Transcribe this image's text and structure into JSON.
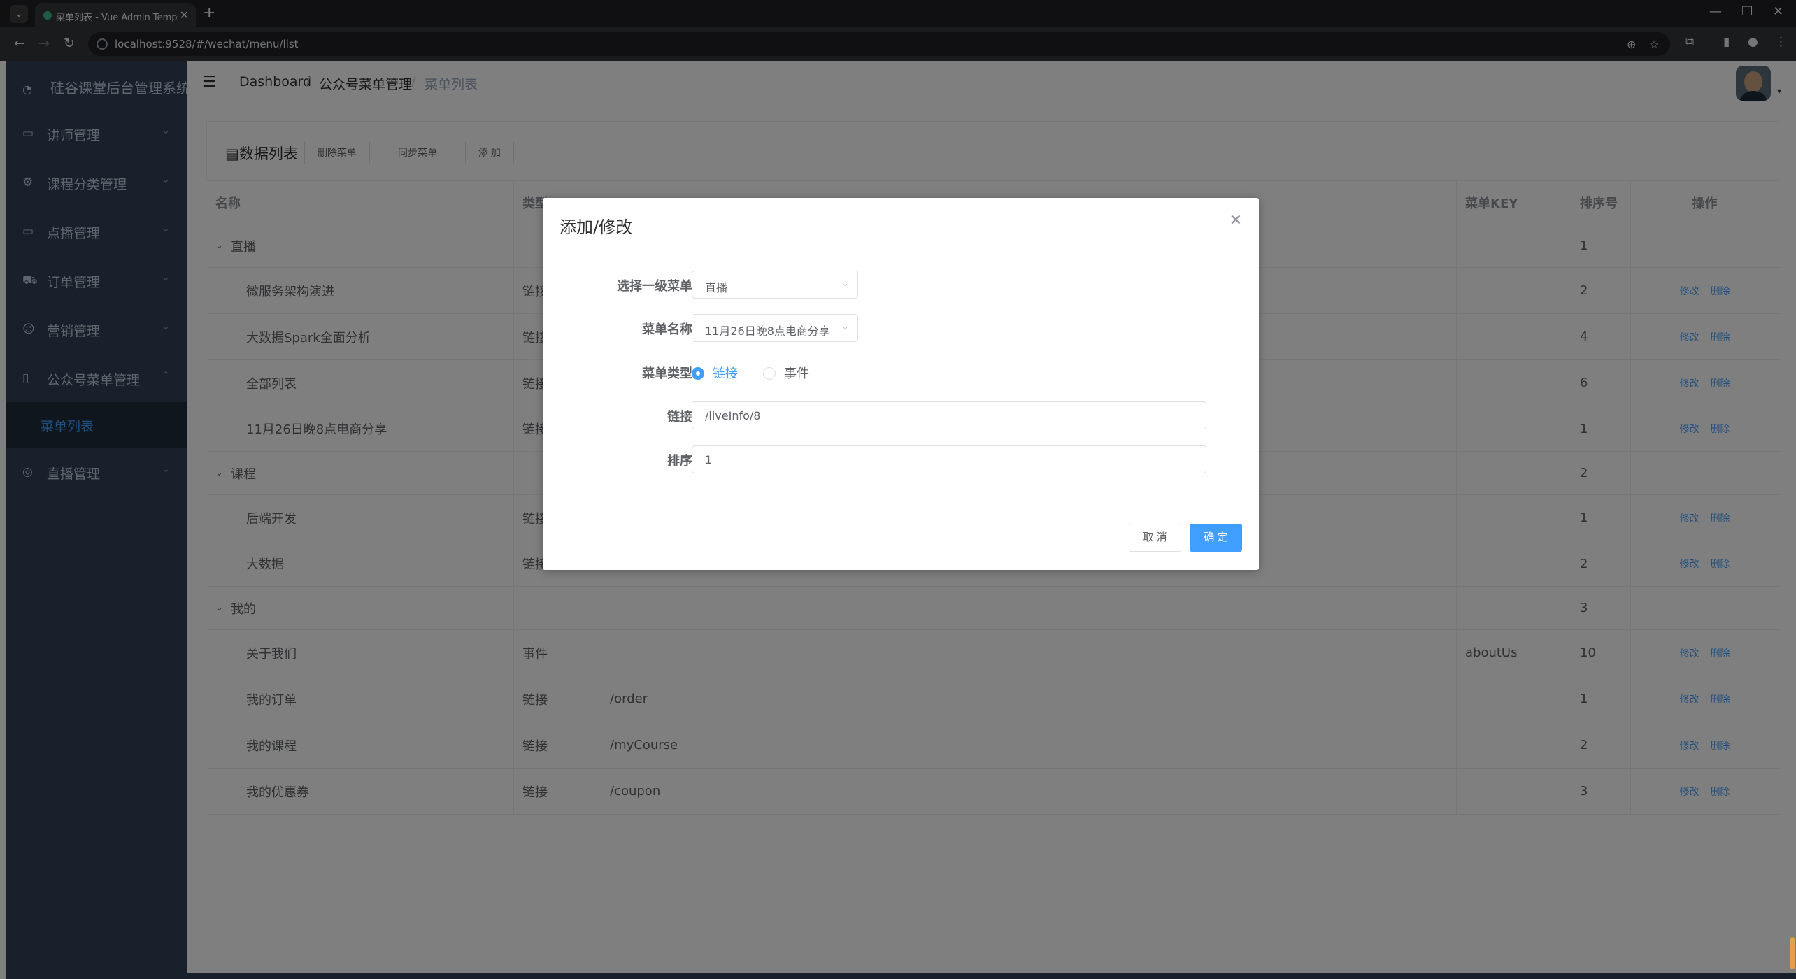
{
  "browser": {
    "tab_title": "菜单列表 - Vue Admin Template",
    "url": "localhost:9528/#/wechat/menu/list",
    "new_tab_symbol": "+",
    "close_symbol": "✕",
    "window_controls": [
      "—",
      "❐",
      "✕"
    ]
  },
  "sidebar": {
    "logo_text": "硅谷课堂后台管理系统",
    "items": [
      {
        "label": "讲师管理",
        "icon": "table-icon"
      },
      {
        "label": "课程分类管理",
        "icon": "category-icon"
      },
      {
        "label": "点播管理",
        "icon": "video-icon"
      },
      {
        "label": "订单管理",
        "icon": "truck-icon"
      },
      {
        "label": "营销管理",
        "icon": "smile-icon"
      },
      {
        "label": "公众号菜单管理",
        "icon": "phone-icon"
      },
      {
        "label": "直播管理",
        "icon": "live-icon"
      }
    ],
    "active_sub": "菜单列表"
  },
  "breadcrumb": {
    "items": [
      "Dashboard",
      "公众号菜单管理",
      "菜单列表"
    ],
    "separator": "/"
  },
  "panel": {
    "title": "数据列表",
    "buttons": {
      "delete_menu": "删除菜单",
      "sync_menu": "同步菜单",
      "add": "添 加"
    }
  },
  "table": {
    "headers": {
      "name": "名称",
      "type": "类型",
      "url": "",
      "key": "菜单KEY",
      "sort": "排序号",
      "ops": "操作"
    },
    "op_edit": "修改",
    "op_delete": "删除",
    "rows": [
      {
        "name": "直播",
        "type": "",
        "url": "",
        "key": "",
        "sort": "1",
        "parent": true,
        "ops": false
      },
      {
        "name": "微服务架构演进",
        "type": "链接",
        "url": "",
        "key": "",
        "sort": "2",
        "parent": false,
        "ops": true
      },
      {
        "name": "大数据Spark全面分析",
        "type": "链接",
        "url": "",
        "key": "",
        "sort": "4",
        "parent": false,
        "ops": true
      },
      {
        "name": "全部列表",
        "type": "链接",
        "url": "",
        "key": "",
        "sort": "6",
        "parent": false,
        "ops": true
      },
      {
        "name": "11月26日晚8点电商分享",
        "type": "链接",
        "url": "",
        "key": "",
        "sort": "1",
        "parent": false,
        "ops": true
      },
      {
        "name": "课程",
        "type": "",
        "url": "",
        "key": "",
        "sort": "2",
        "parent": true,
        "ops": false
      },
      {
        "name": "后端开发",
        "type": "链接",
        "url": "",
        "key": "",
        "sort": "1",
        "parent": false,
        "ops": true
      },
      {
        "name": "大数据",
        "type": "链接",
        "url": "",
        "key": "",
        "sort": "2",
        "parent": false,
        "ops": true
      },
      {
        "name": "我的",
        "type": "",
        "url": "",
        "key": "",
        "sort": "3",
        "parent": true,
        "ops": false
      },
      {
        "name": "关于我们",
        "type": "事件",
        "url": "",
        "key": "aboutUs",
        "sort": "10",
        "parent": false,
        "ops": true
      },
      {
        "name": "我的订单",
        "type": "链接",
        "url": "/order",
        "key": "",
        "sort": "1",
        "parent": false,
        "ops": true
      },
      {
        "name": "我的课程",
        "type": "链接",
        "url": "/myCourse",
        "key": "",
        "sort": "2",
        "parent": false,
        "ops": true
      },
      {
        "name": "我的优惠券",
        "type": "链接",
        "url": "/coupon",
        "key": "",
        "sort": "3",
        "parent": false,
        "ops": true
      }
    ]
  },
  "dialog": {
    "title": "添加/修改",
    "parent_menu_label": "选择一级菜单",
    "parent_menu_value": "直播",
    "menu_name_label": "菜单名称",
    "menu_name_value": "11月26日晚8点电商分享",
    "menu_type_label": "菜单类型",
    "type_options": [
      "链接",
      "事件"
    ],
    "selected_type": "链接",
    "url_label": "链接",
    "url_value": "/liveInfo/8",
    "sort_label": "排序",
    "sort_value": "1",
    "cancel": "取 消",
    "ok": "确 定"
  },
  "colors": {
    "sidebar_bg": "#304156",
    "sidebar_active_bg": "#1f2d3d",
    "primary": "#409eff",
    "sidebar_text": "#bfcbd9"
  }
}
